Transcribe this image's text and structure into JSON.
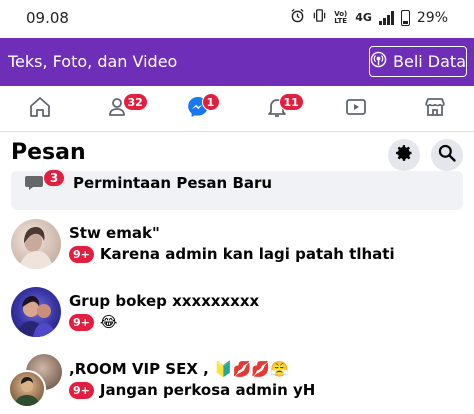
{
  "status_bar": {
    "time": "09.08",
    "volte": "Vo) LTE",
    "network": "4G",
    "battery": "29%",
    "icons": [
      "alarm-icon",
      "vibrate-icon",
      "volte-icon",
      "signal-icon",
      "battery-icon"
    ]
  },
  "promo": {
    "text": "Teks, Foto, dan Video",
    "button_label": "Beli Data",
    "button_icon": "broadcast-icon",
    "background": "#6f2eb8"
  },
  "nav": {
    "tabs": [
      {
        "icon": "home-icon",
        "badge": ""
      },
      {
        "icon": "friends-icon",
        "badge": "32"
      },
      {
        "icon": "messenger-icon",
        "badge": "1"
      },
      {
        "icon": "bell-icon",
        "badge": "11"
      },
      {
        "icon": "video-icon",
        "badge": ""
      },
      {
        "icon": "marketplace-icon",
        "badge": ""
      }
    ],
    "active_color": "#1877f2"
  },
  "header": {
    "title": "Pesan",
    "settings_icon": "gear-icon",
    "search_icon": "search-icon"
  },
  "requests": {
    "badge": "3",
    "label": "Permintaan Pesan Baru"
  },
  "conversations": [
    {
      "name": "Stw emak\"",
      "unread": "9+",
      "preview": "Karena admin kan lagi patah tlhati"
    },
    {
      "name": "Grup bokep xxxxxxxxx",
      "unread": "9+",
      "preview": "😂"
    },
    {
      "name": ",ROOM VIP SEX , 🔰💋💋😤",
      "unread": "9+",
      "preview": "Jangan perkosa admin yH"
    }
  ],
  "badge_color": "#e41e3f"
}
